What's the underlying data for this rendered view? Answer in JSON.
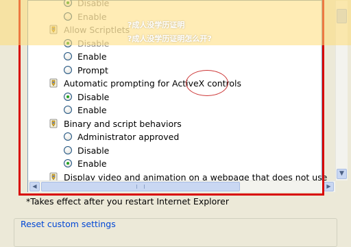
{
  "settings": [
    {
      "type": "option",
      "label": "Disable",
      "selected": true,
      "disabled": true
    },
    {
      "type": "option",
      "label": "Enable",
      "selected": false,
      "disabled": true
    },
    {
      "type": "setting",
      "label": "Allow Scriptlets",
      "disabled": true
    },
    {
      "type": "option",
      "label": "Disable",
      "selected": true,
      "disabled": true
    },
    {
      "type": "option",
      "label": "Enable",
      "selected": false,
      "disabled": false
    },
    {
      "type": "option",
      "label": "Prompt",
      "selected": false,
      "disabled": false
    },
    {
      "type": "setting",
      "label": "Automatic prompting for ActiveX controls",
      "disabled": false
    },
    {
      "type": "option",
      "label": "Disable",
      "selected": true,
      "disabled": false
    },
    {
      "type": "option",
      "label": "Enable",
      "selected": false,
      "disabled": false
    },
    {
      "type": "setting",
      "label": "Binary and script behaviors",
      "disabled": false
    },
    {
      "type": "option",
      "label": "Administrator approved",
      "selected": false,
      "disabled": false
    },
    {
      "type": "option",
      "label": "Disable",
      "selected": false,
      "disabled": false
    },
    {
      "type": "option",
      "label": "Enable",
      "selected": true,
      "disabled": false
    },
    {
      "type": "setting",
      "label": "Display video and animation on a webpage that does not use",
      "disabled": false
    }
  ],
  "note": "*Takes effect after you restart Internet Explorer",
  "reset_group_title": "Reset custom settings",
  "watermark": {
    "line1": "?成人没学历证明",
    "line2": "?成人没学历证明怎么开?"
  },
  "scrollbar": {
    "up_arrow": "▲",
    "down_arrow": "▼",
    "left_arrow": "◀",
    "right_arrow": "▶"
  },
  "colors": {
    "highlight_box": "#d80000",
    "radio_dot": "#21a121",
    "group_title": "#0046d5"
  }
}
